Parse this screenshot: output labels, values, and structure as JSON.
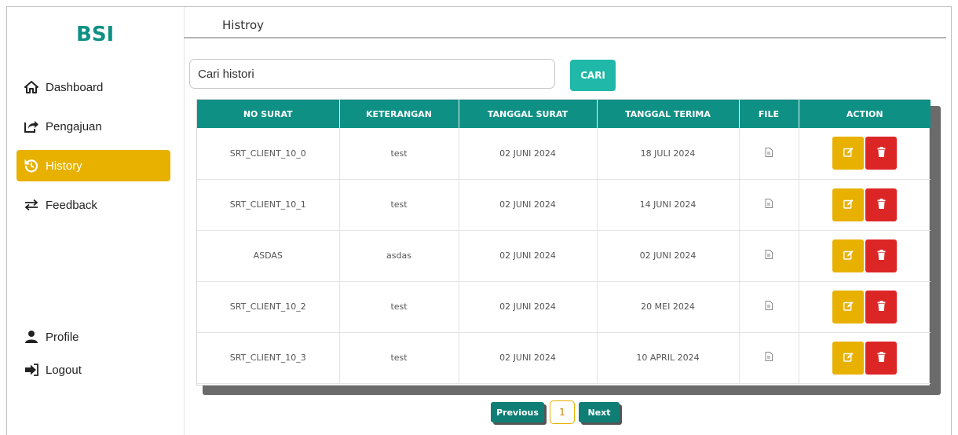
{
  "sidebar": {
    "brand": "BSI",
    "items": [
      {
        "label": "Dashboard",
        "icon": "home-icon"
      },
      {
        "label": "Pengajuan",
        "icon": "share-icon"
      },
      {
        "label": "History",
        "icon": "history-icon",
        "active": true
      },
      {
        "label": "Feedback",
        "icon": "exchange-icon"
      }
    ],
    "bottom_items": [
      {
        "label": "Profile",
        "icon": "user-icon"
      },
      {
        "label": "Logout",
        "icon": "logout-icon"
      }
    ]
  },
  "header": {
    "title": "Histroy"
  },
  "search": {
    "placeholder": "Cari histori",
    "value": "",
    "button_label": "CARI"
  },
  "table": {
    "columns": [
      "NO SURAT",
      "KETERANGAN",
      "TANGGAL SURAT",
      "TANGGAL TERIMA",
      "FILE",
      "ACTION"
    ],
    "rows": [
      {
        "no_surat": "SRT_CLIENT_10_0",
        "keterangan": "test",
        "tanggal_surat": "02 JUNI 2024",
        "tanggal_terima": "18 JULI 2024"
      },
      {
        "no_surat": "SRT_CLIENT_10_1",
        "keterangan": "test",
        "tanggal_surat": "02 JUNI 2024",
        "tanggal_terima": "14 JUNI 2024"
      },
      {
        "no_surat": "ASDAS",
        "keterangan": "asdas",
        "tanggal_surat": "02 JUNI 2024",
        "tanggal_terima": "02 JUNI 2024"
      },
      {
        "no_surat": "SRT_CLIENT_10_2",
        "keterangan": "test",
        "tanggal_surat": "02 JUNI 2024",
        "tanggal_terima": "20 MEI 2024"
      },
      {
        "no_surat": "SRT_CLIENT_10_3",
        "keterangan": "test",
        "tanggal_surat": "02 JUNI 2024",
        "tanggal_terima": "10 APRIL 2024"
      }
    ]
  },
  "pagination": {
    "previous": "Previous",
    "current": "1",
    "next": "Next"
  },
  "colors": {
    "brand": "#0f9085",
    "accent": "#e8b100",
    "danger": "#dc2626",
    "search_button": "#20b8a8"
  }
}
